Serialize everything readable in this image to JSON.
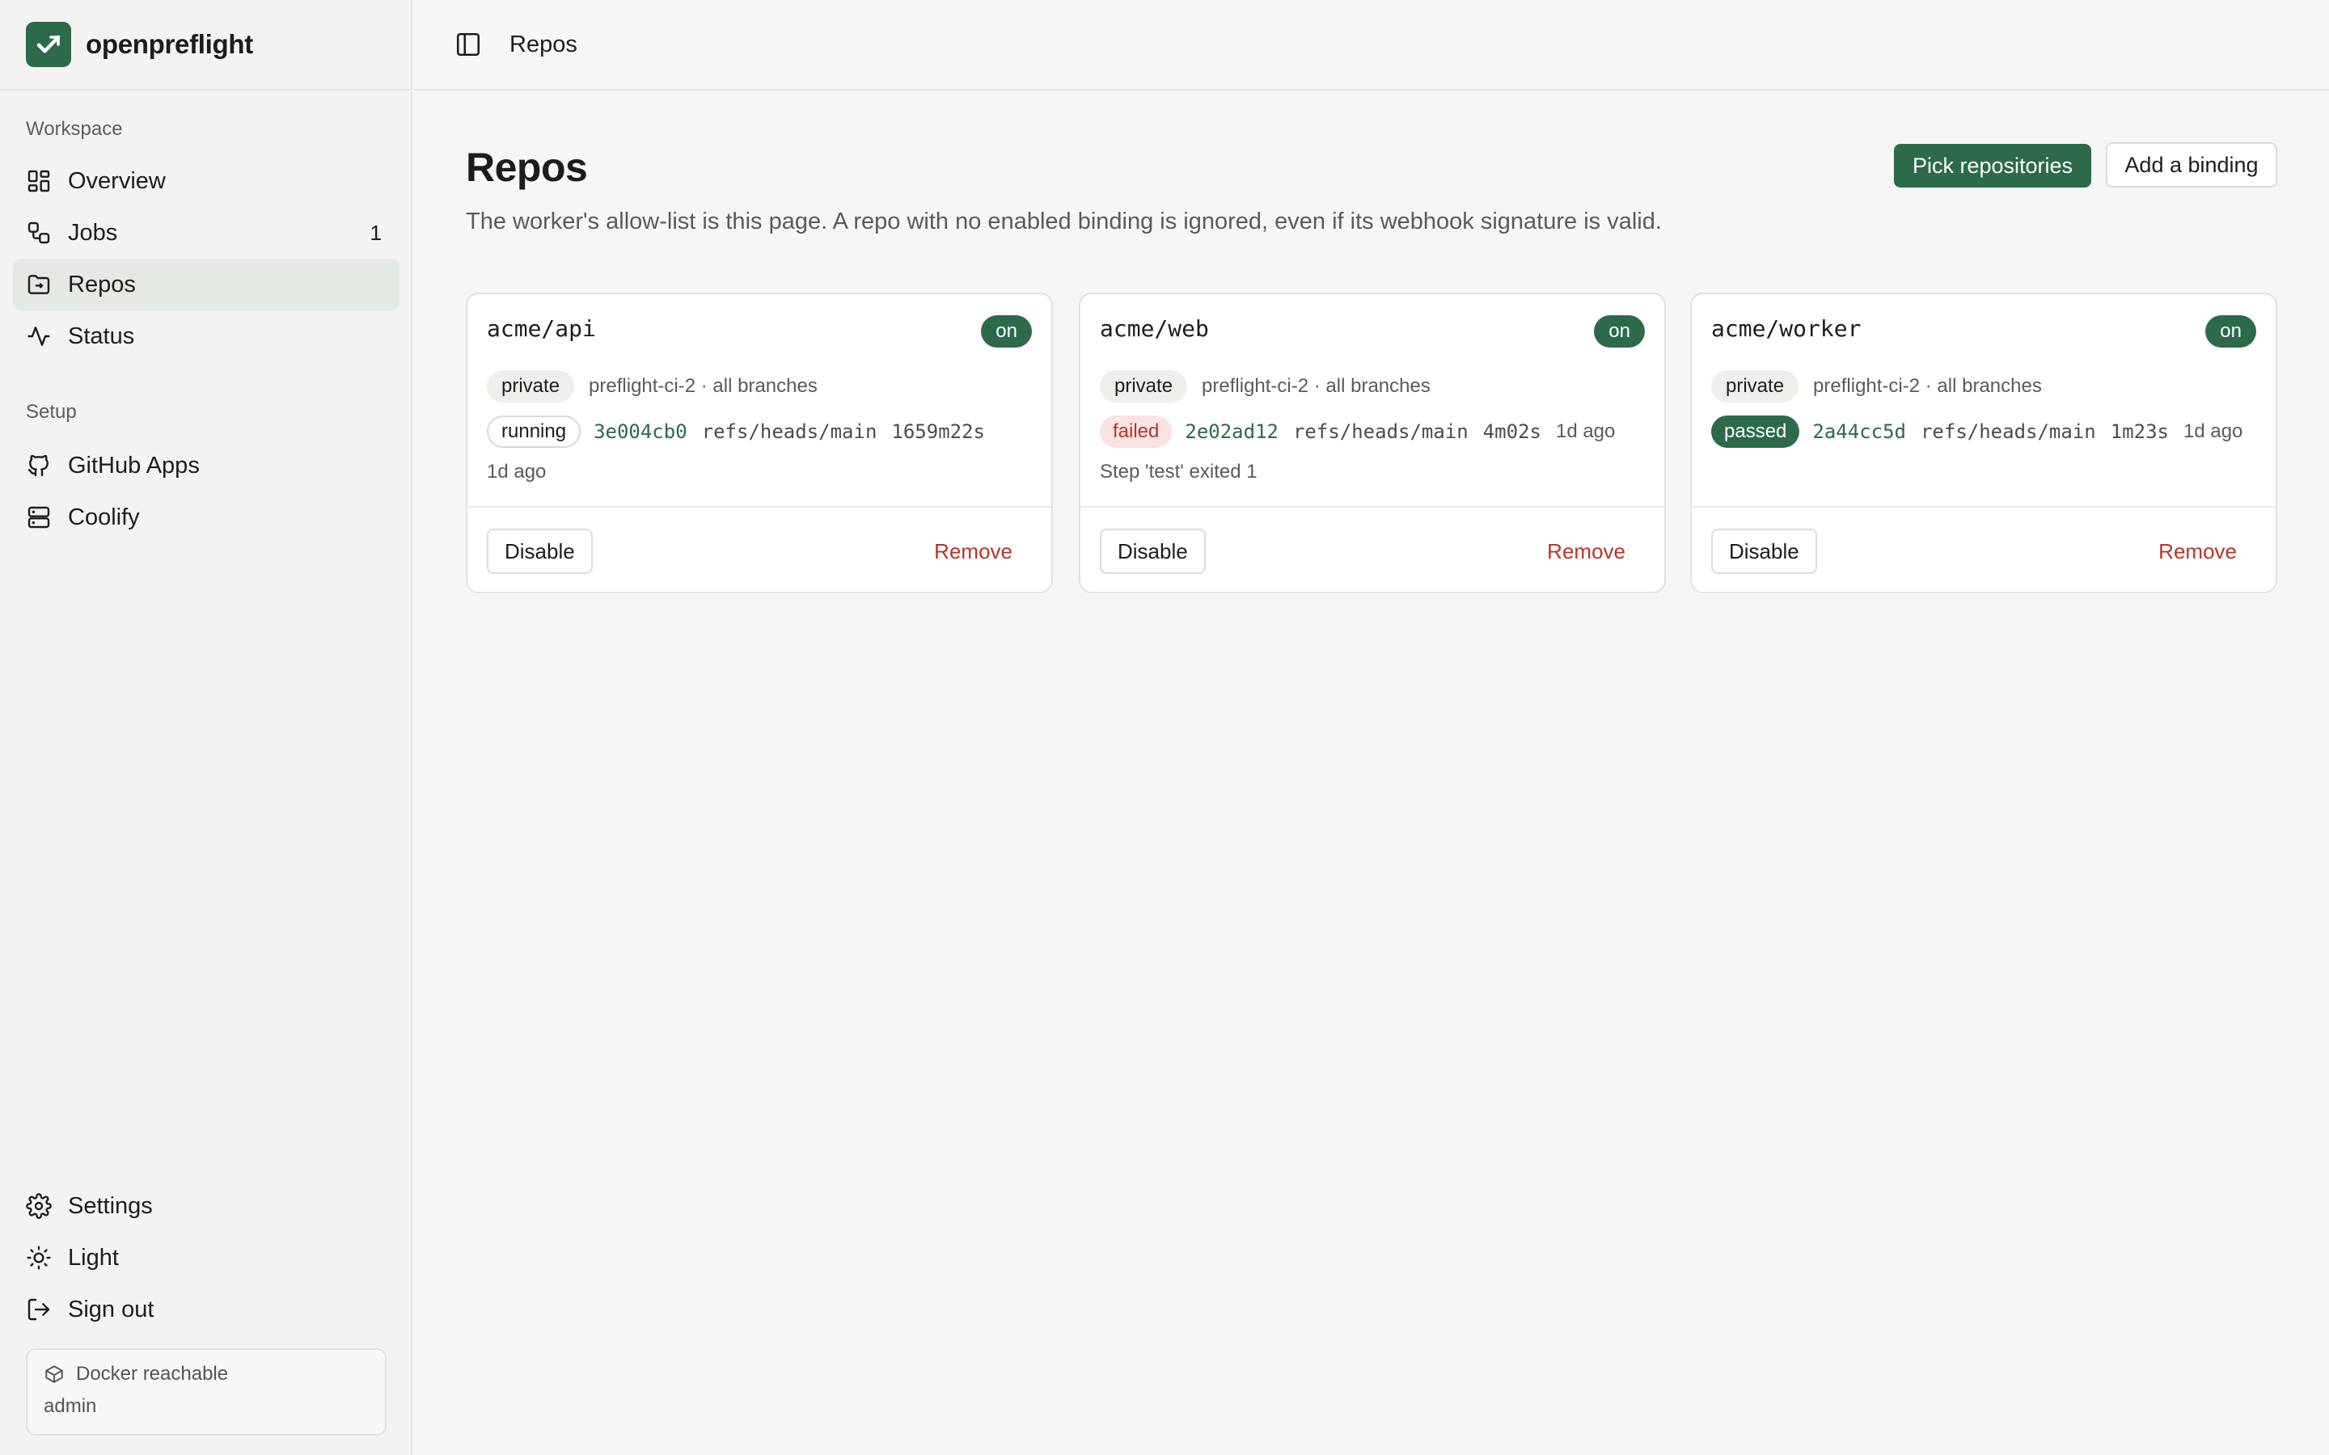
{
  "brand": {
    "name": "openpreflight"
  },
  "sidebar": {
    "workspace_label": "Workspace",
    "items": [
      {
        "label": "Overview",
        "icon": "grid-icon"
      },
      {
        "label": "Jobs",
        "icon": "workflow-icon",
        "count": "1"
      },
      {
        "label": "Repos",
        "icon": "folder-icon",
        "active": true
      },
      {
        "label": "Status",
        "icon": "activity-icon"
      }
    ],
    "setup_label": "Setup",
    "setup_items": [
      {
        "label": "GitHub Apps",
        "icon": "github-icon"
      },
      {
        "label": "Coolify",
        "icon": "server-icon"
      }
    ],
    "bottom_items": [
      {
        "label": "Settings",
        "icon": "gear-icon"
      },
      {
        "label": "Light",
        "icon": "sun-icon"
      },
      {
        "label": "Sign out",
        "icon": "logout-icon"
      }
    ],
    "status": {
      "text": "Docker reachable",
      "user": "admin"
    }
  },
  "header": {
    "breadcrumb": "Repos"
  },
  "main": {
    "title": "Repos",
    "description": "The worker's allow-list is this page. A repo with no enabled binding is ignored, even if its webhook signature is valid.",
    "pick_button": "Pick repositories",
    "add_button": "Add a binding",
    "cards": [
      {
        "name": "acme/api",
        "toggle": "on",
        "visibility": "private",
        "meta": "preflight-ci-2 · all branches",
        "run_status": "running",
        "sha": "3e004cb0",
        "ref": "refs/heads/main",
        "duration": "1659m22s",
        "ago": "1d ago",
        "note": "",
        "disable_label": "Disable",
        "remove_label": "Remove"
      },
      {
        "name": "acme/web",
        "toggle": "on",
        "visibility": "private",
        "meta": "preflight-ci-2 · all branches",
        "run_status": "failed",
        "sha": "2e02ad12",
        "ref": "refs/heads/main",
        "duration": "4m02s",
        "ago": "1d ago",
        "note": "Step 'test' exited 1",
        "disable_label": "Disable",
        "remove_label": "Remove"
      },
      {
        "name": "acme/worker",
        "toggle": "on",
        "visibility": "private",
        "meta": "preflight-ci-2 · all branches",
        "run_status": "passed",
        "sha": "2a44cc5d",
        "ref": "refs/heads/main",
        "duration": "1m23s",
        "ago": "1d ago",
        "note": "",
        "disable_label": "Disable",
        "remove_label": "Remove"
      }
    ]
  },
  "colors": {
    "accent": "#2c6a4a",
    "danger": "#b3362c",
    "background": "#f6f6f4"
  }
}
